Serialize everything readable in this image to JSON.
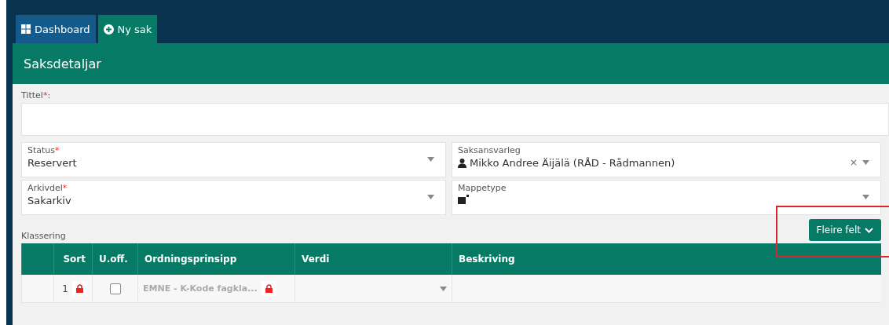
{
  "tabs": [
    {
      "label": "Dashboard",
      "selected": false
    },
    {
      "label": "Ny sak",
      "selected": true
    }
  ],
  "panel": {
    "title": "Saksdetaljar"
  },
  "title_field": {
    "label": "Tittel",
    "mark": "*",
    "suffix": ":"
  },
  "fields": [
    {
      "label": "Status",
      "mark": "*",
      "value": "Reservert"
    },
    {
      "label": "Saksansvarleg",
      "value": "Mikko Andree Äijälä (RÅD - Rådmannen)",
      "kind": "person",
      "clear": "×"
    },
    {
      "label": "Arkivdel",
      "mark": "*",
      "value": "Sakarkiv"
    },
    {
      "label": "Mappetype",
      "kind": "icon"
    }
  ],
  "more_button": {
    "label": "Fleire felt"
  },
  "classification": {
    "label": "Klassering",
    "columns": [
      "",
      "Sort",
      "U.off.",
      "Ordningsprinsipp",
      "Verdi",
      "Beskriving"
    ],
    "rows": [
      {
        "sort": "1",
        "sort_locked": true,
        "restricted": false,
        "principle": "EMNE - K-Kode fagkla...",
        "principle_locked": true
      }
    ]
  }
}
